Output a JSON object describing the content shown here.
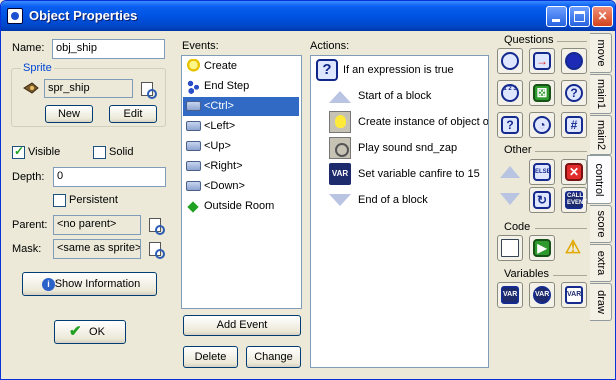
{
  "window": {
    "title": "Object Properties"
  },
  "name": {
    "label": "Name:",
    "value": "obj_ship"
  },
  "sprite": {
    "group_title": "Sprite",
    "value": "spr_ship",
    "new_label": "New",
    "edit_label": "Edit"
  },
  "visible": {
    "label": "Visible",
    "checked": true
  },
  "solid": {
    "label": "Solid",
    "checked": false
  },
  "depth": {
    "label": "Depth:",
    "value": "0"
  },
  "persistent": {
    "label": "Persistent",
    "checked": false
  },
  "parent": {
    "label": "Parent:",
    "value": "<no parent>"
  },
  "mask": {
    "label": "Mask:",
    "value": "<same as sprite>"
  },
  "buttons": {
    "show_info": "Show Information",
    "ok": "OK",
    "add_event": "Add Event",
    "delete": "Delete",
    "change": "Change"
  },
  "events": {
    "title": "Events:",
    "items": [
      {
        "label": "Create",
        "icon": "bulb-icon"
      },
      {
        "label": "End Step",
        "icon": "footsteps-icon"
      },
      {
        "label": "<Ctrl>",
        "icon": "keyboard-icon",
        "selected": true
      },
      {
        "label": "<Left>",
        "icon": "keyboard-icon"
      },
      {
        "label": "<Up>",
        "icon": "keyboard-icon"
      },
      {
        "label": "<Right>",
        "icon": "keyboard-icon"
      },
      {
        "label": "<Down>",
        "icon": "keyboard-icon"
      },
      {
        "label": "Outside Room",
        "icon": "diamond-icon"
      }
    ]
  },
  "actions": {
    "title": "Actions:",
    "items": [
      {
        "label": "If an expression is true",
        "icon": "question-icon"
      },
      {
        "label": "Start of a block",
        "icon": "block-start-icon"
      },
      {
        "label": "Create instance of object o",
        "icon": "create-instance-icon"
      },
      {
        "label": "Play sound snd_zap",
        "icon": "sound-icon"
      },
      {
        "label": "Set variable canfire to 15",
        "icon": "var-icon",
        "icon_text": "VAR"
      },
      {
        "label": "End of a block",
        "icon": "block-end-icon"
      }
    ]
  },
  "palette": {
    "questions_title": "Questions",
    "other_title": "Other",
    "code_title": "Code",
    "variables_title": "Variables",
    "else_text": "ELSE",
    "call_text": "CALL EVENT",
    "var_text": "VAR",
    "qmark": "?"
  },
  "tabs": [
    "move",
    "main1",
    "main2",
    "control",
    "score",
    "extra",
    "draw"
  ],
  "active_tab": "control"
}
